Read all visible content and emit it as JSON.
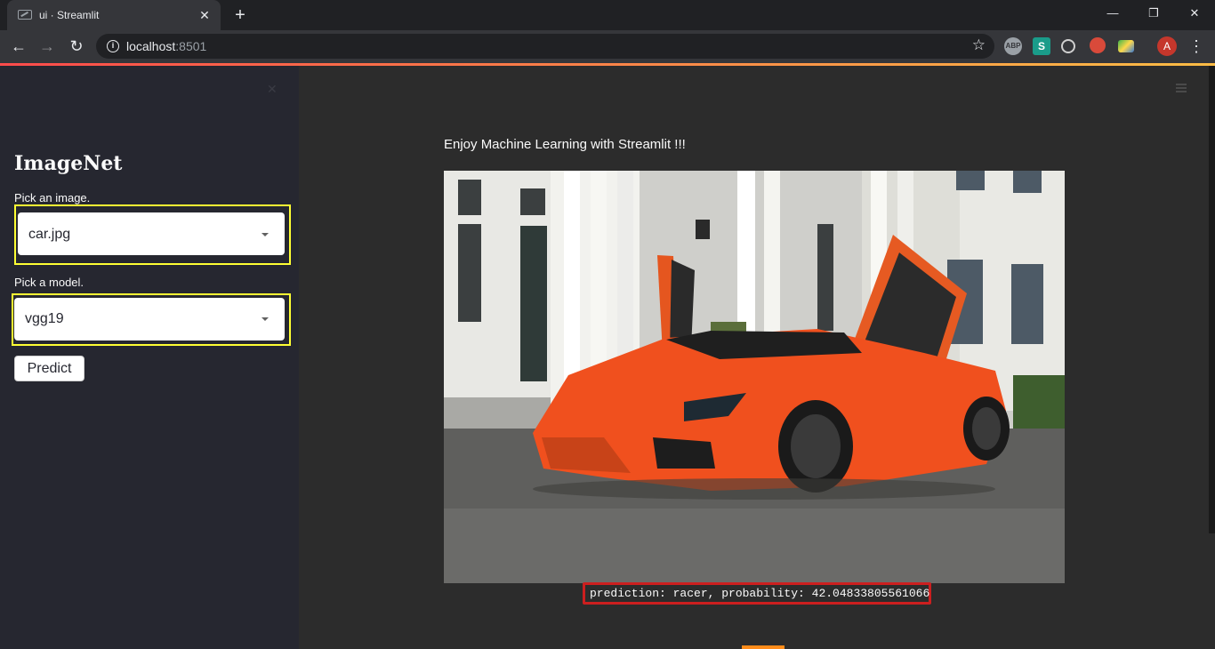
{
  "browser": {
    "tab_title": "ui · Streamlit",
    "new_tab": "+",
    "url_host": "localhost",
    "url_port": ":8501",
    "avatar_letter": "A",
    "extensions": [
      "ABP",
      "S",
      "globe",
      "santa",
      "color"
    ]
  },
  "sidebar": {
    "title": "ImageNet",
    "image_label": "Pick an image.",
    "image_value": "car.jpg",
    "model_label": "Pick a model.",
    "model_value": "vgg19",
    "predict_label": "Predict"
  },
  "main": {
    "subtitle": "Enjoy Machine Learning with Streamlit !!!",
    "result": "prediction: racer, probability: 42.04833805561066"
  },
  "colors": {
    "highlight": "#ffff33",
    "result_border": "#cc1f1f",
    "car": "#f0501e",
    "accent_start": "#ff4b4b",
    "accent_end": "#ffbd45"
  }
}
